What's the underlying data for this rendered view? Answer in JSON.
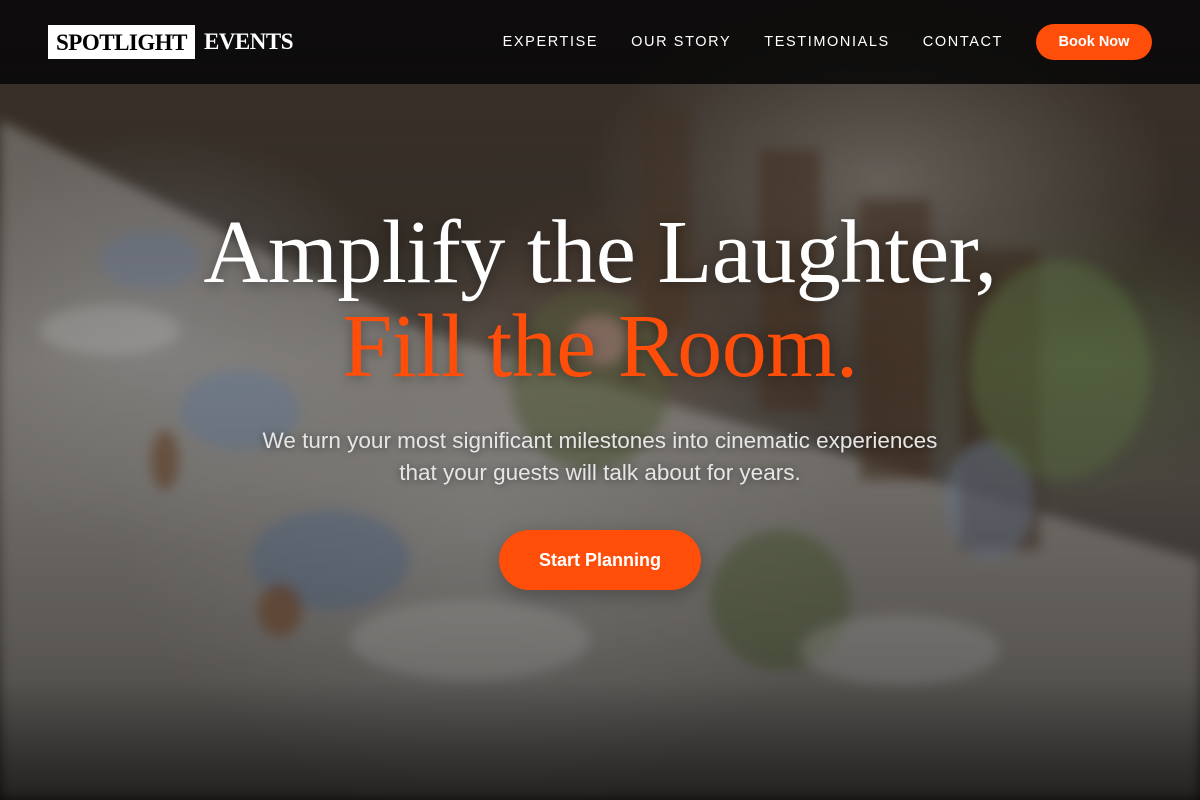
{
  "brand": {
    "logo_box_text": "SPOTLIGHT",
    "logo_rest_text": "EVENTS"
  },
  "nav": {
    "links": [
      {
        "label": "EXPERTISE"
      },
      {
        "label": "OUR STORY"
      },
      {
        "label": "TESTIMONIALS"
      },
      {
        "label": "CONTACT"
      }
    ],
    "cta_label": "Book Now"
  },
  "hero": {
    "heading_line1": "Amplify the Laughter,",
    "heading_line2": "Fill the Room.",
    "subtitle": "We turn your most significant milestones into cinematic experiences that your guests will talk about for years.",
    "cta_label": "Start Planning"
  },
  "colors": {
    "accent": "#ff4d0a",
    "navbar": "#080808",
    "text": "#ffffff"
  }
}
